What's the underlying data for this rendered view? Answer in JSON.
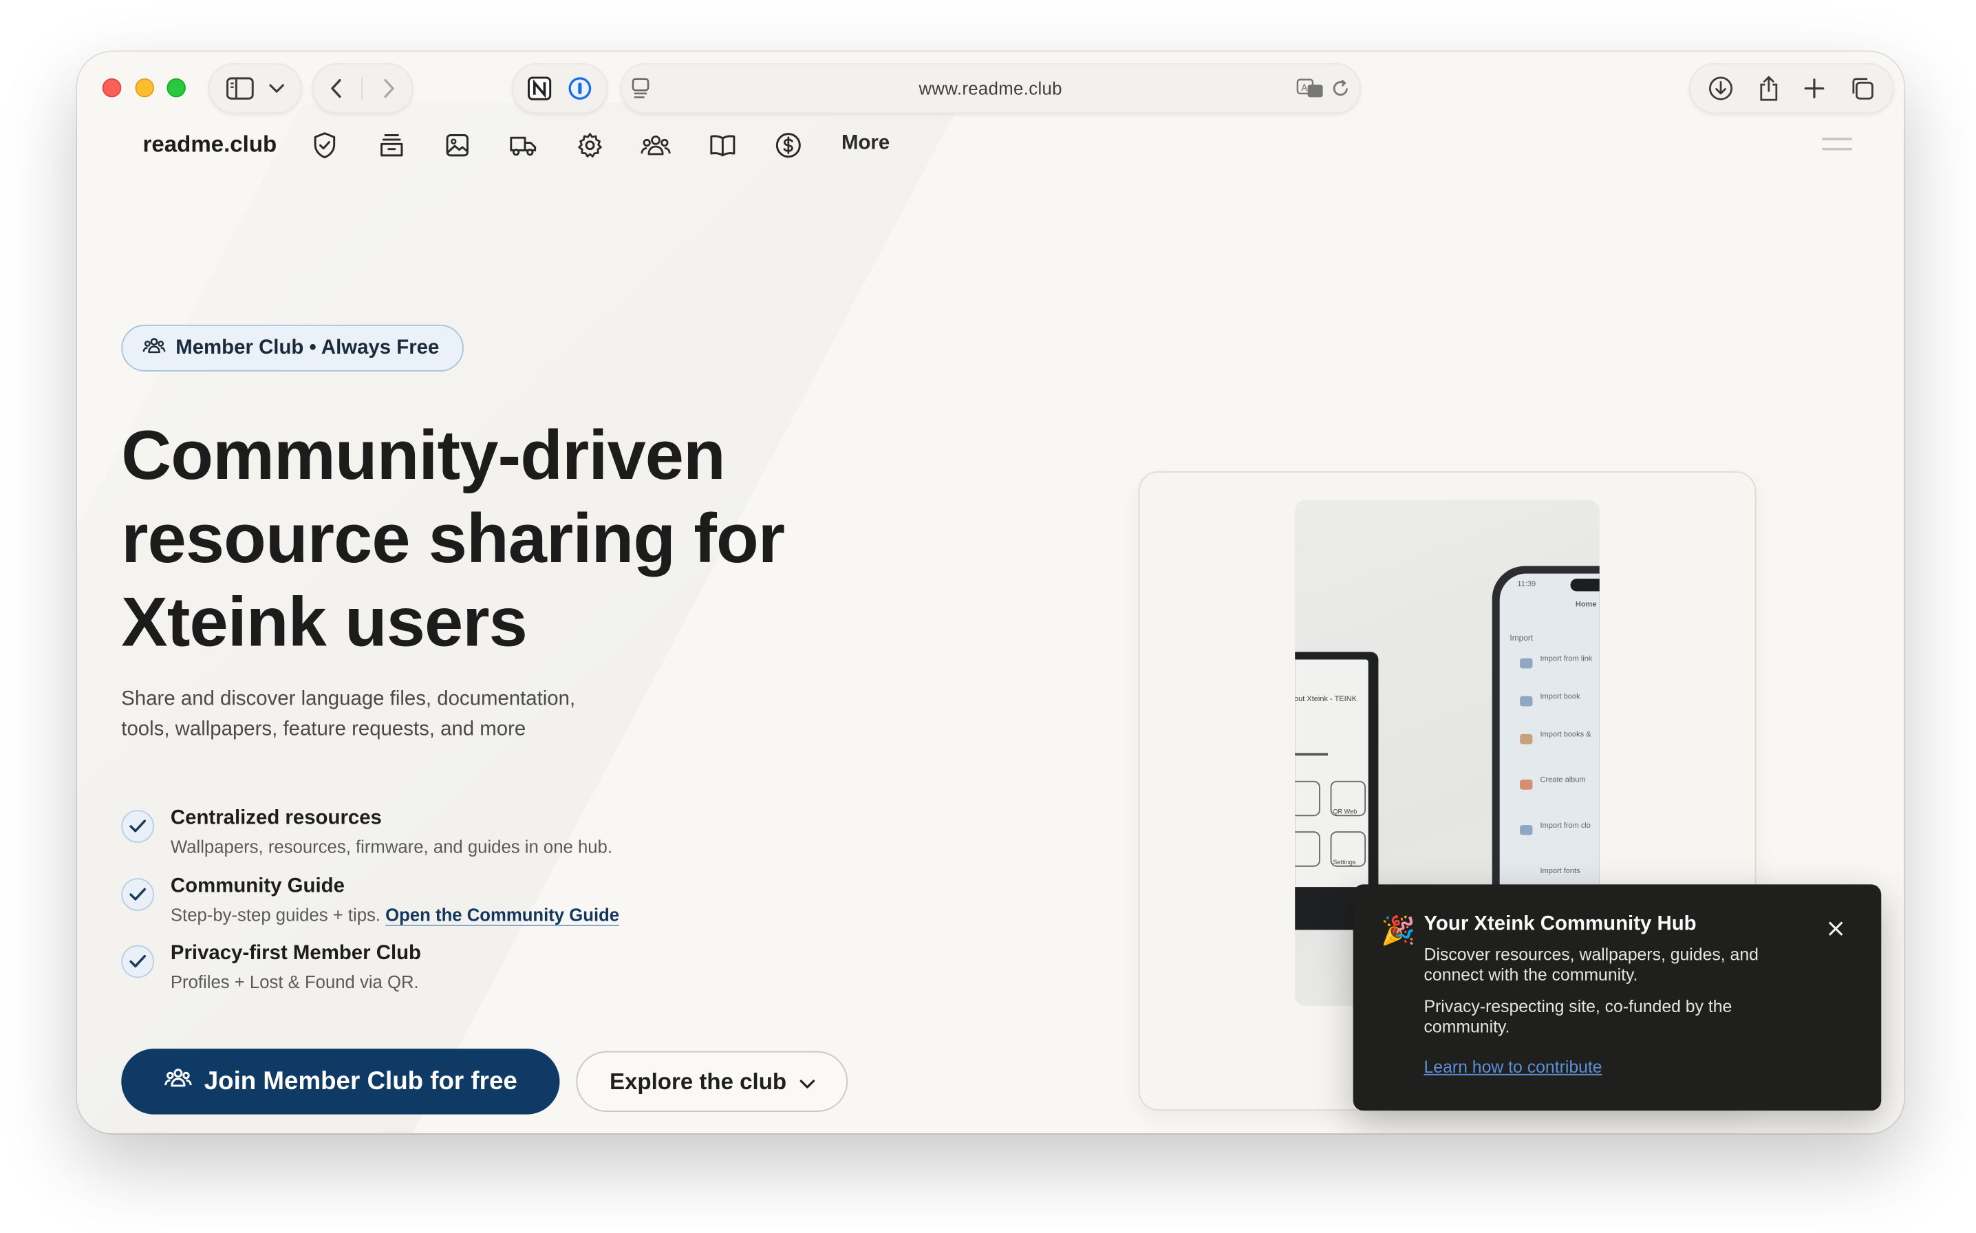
{
  "browser": {
    "url": "www.readme.club"
  },
  "nav": {
    "brand": "readme.club",
    "icons": [
      "shield-check-icon",
      "archive-box-icon",
      "image-icon",
      "truck-icon",
      "gear-icon",
      "users-icon",
      "open-book-icon",
      "dollar-circle-icon"
    ],
    "more_label": "More"
  },
  "hero": {
    "badge_label": "Member Club • Always Free",
    "title": "Community-driven resource sharing for Xteink users",
    "subtitle": "Share and discover language files, documentation, tools, wallpapers, feature requests, and more",
    "features": [
      {
        "title": "Centralized resources",
        "desc": "Wallpapers, resources, firmware, and guides in one hub."
      },
      {
        "title": "Community Guide",
        "desc": "Step-by-step guides + tips.",
        "link": "Open the Community Guide"
      },
      {
        "title": "Privacy-first Member Club",
        "desc": "Profiles + Lost & Found via QR."
      }
    ],
    "primary_button": "Join Member Club for free",
    "secondary_button": "Explore the club"
  },
  "showcase": {
    "phone_time": "11:39",
    "phone_header": "Home",
    "phone_section": "Import",
    "phone_items": [
      "Import from link",
      "Import book",
      "Import books &",
      "Create album",
      "Import from clo",
      "Import fonts"
    ],
    "ereader_text": "bout Xteink - TEINK",
    "ereader_labels": [
      "QR Web",
      "Settings"
    ]
  },
  "toast": {
    "emoji": "🎉",
    "title": "Your Xteink Community Hub",
    "body": "Discover resources, wallpapers, guides, and connect with the community.",
    "note": "Privacy-respecting site, co-funded by the community.",
    "link": "Learn how to contribute"
  }
}
